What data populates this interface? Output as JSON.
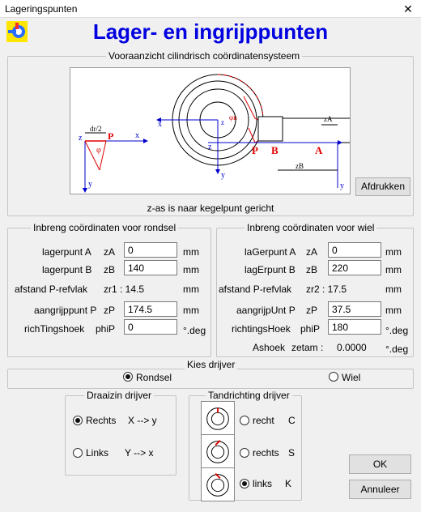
{
  "window": {
    "title": "Lageringspunten",
    "close_glyph": "✕"
  },
  "header": {
    "title": "Lager- en ingrijppunten"
  },
  "view": {
    "legend": "Vooraanzicht cilindrisch coördinatensysteem",
    "note": "z-as is naar kegelpunt gericht",
    "print_button": "Afdrukken",
    "diagram_labels": {
      "z": "z",
      "x": "x",
      "y": "y",
      "P": "P",
      "B": "B",
      "A": "A",
      "phi": "φ",
      "r2": "dr/2",
      "zA": "zA",
      "zB": "zB",
      "phiT": "φn"
    }
  },
  "rondsel": {
    "legend": "Inbreng coördinaten voor rondsel",
    "rows": [
      {
        "label": "lagerpunt A",
        "sym": "zA",
        "value": "0",
        "unit": "mm"
      },
      {
        "label": "lagerpunt B",
        "sym": "zB",
        "value": "140",
        "unit": "mm"
      },
      {
        "label": "afstand P-refvlak",
        "sym": "zr1 : 14.5",
        "unit": "mm"
      },
      {
        "label": "aangrijppunt P",
        "sym": "zP",
        "value": "174.5",
        "unit": "mm"
      },
      {
        "label": "richTingshoek",
        "sym": "phiP",
        "value": "0",
        "unit": "°.deg"
      }
    ]
  },
  "wiel": {
    "legend": "Inbreng coördinaten voor wiel",
    "rows": [
      {
        "label": "laGerpunt A",
        "sym": "zA",
        "value": "0",
        "unit": "mm"
      },
      {
        "label": "lagErpunt B",
        "sym": "zB",
        "value": "220",
        "unit": "mm"
      },
      {
        "label": "afstand P-refvlak",
        "sym": "zr2 : 17.5",
        "unit": "mm"
      },
      {
        "label": "aangrijpUnt P",
        "sym": "zP",
        "value": "37.5",
        "unit": "mm"
      },
      {
        "label": "richtingsHoek",
        "sym": "phiP",
        "value": "180",
        "unit": "°.deg"
      },
      {
        "label": "Ashoek",
        "sym": "zetam :",
        "readout": "0.0000",
        "unit": "°.deg"
      }
    ]
  },
  "driver": {
    "legend": "Kies drijver",
    "options": [
      "Rondsel",
      "Wiel"
    ],
    "selected": "Rondsel"
  },
  "rotation": {
    "legend": "Draaizin drijver",
    "options": [
      {
        "label": "Rechts",
        "desc": "X --> y",
        "selected": true
      },
      {
        "label": "Links",
        "desc": "Y --> x",
        "selected": false
      }
    ]
  },
  "teeth": {
    "legend": "Tandrichting drijver",
    "options": [
      {
        "label": "recht",
        "code": "C",
        "selected": false
      },
      {
        "label": "rechts",
        "code": "S",
        "selected": false
      },
      {
        "label": "links",
        "code": "K",
        "selected": true
      }
    ]
  },
  "buttons": {
    "ok": "OK",
    "cancel": "Annuleer"
  },
  "colors": {
    "title": "#0000e0",
    "accent_red": "#e00000",
    "axis_blue": "#0000cc"
  }
}
